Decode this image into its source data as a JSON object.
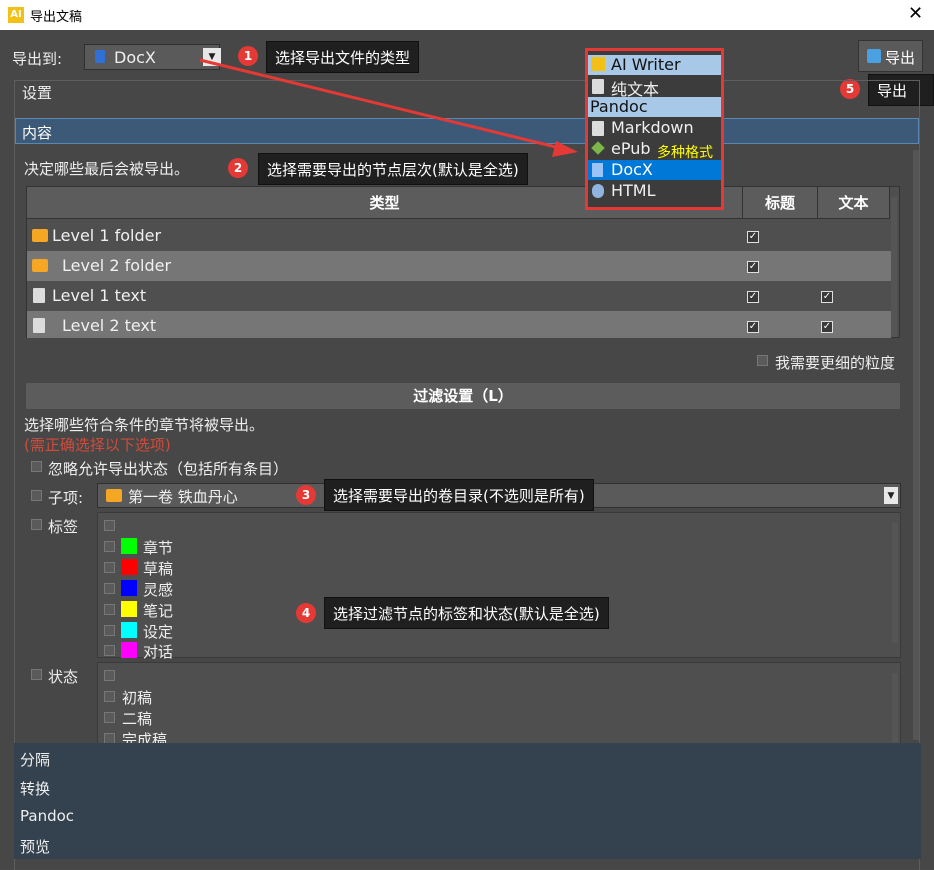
{
  "window": {
    "title": "导出文稿",
    "app_icon": "AI"
  },
  "toolbar": {
    "export_to_label": "导出到:",
    "format_value": "DocX",
    "export_button": "导出"
  },
  "tab": {
    "settings_label": "设置"
  },
  "content_section": {
    "header": "内容",
    "description": "决定哪些最后会被导出。",
    "table": {
      "headers": [
        "类型",
        "标题",
        "文本"
      ],
      "rows": [
        {
          "label": "Level 1 folder",
          "icon": "folder-icon",
          "title": true,
          "text": null
        },
        {
          "label": "Level 2 folder",
          "icon": "folder-icon",
          "title": true,
          "text": null
        },
        {
          "label": "Level 1 text",
          "icon": "document-icon",
          "title": true,
          "text": true
        },
        {
          "label": "Level 2 text",
          "icon": "document-icon",
          "title": true,
          "text": true
        }
      ]
    },
    "finer_granularity": "我需要更细的粒度"
  },
  "filter_section": {
    "header": "过滤设置（L）",
    "description": "选择哪些符合条件的章节将被导出。",
    "warning": "(需正确选择以下选项)",
    "ignore_status_label": "忽略允许导出状态（包括所有条目）",
    "subitem_label": "子项:",
    "subitem_value": "第一卷 铁血丹心",
    "tags_label": "标签",
    "tags": [
      {
        "name": "章节",
        "color": "#00ff00"
      },
      {
        "name": "草稿",
        "color": "#ff0000"
      },
      {
        "name": "灵感",
        "color": "#0000ff"
      },
      {
        "name": "笔记",
        "color": "#ffff00"
      },
      {
        "name": "设定",
        "color": "#00ffff"
      },
      {
        "name": "对话",
        "color": "#ff00ff"
      }
    ],
    "status_label": "状态",
    "statuses": [
      "初稿",
      "二稿",
      "完成稿"
    ]
  },
  "bottom_nav": [
    "分隔",
    "转换",
    "Pandoc",
    "预览"
  ],
  "format_dropdown": {
    "items": [
      {
        "label": "AI Writer",
        "icon": "ai-writer-icon",
        "style": "highlight"
      },
      {
        "label": "纯文本",
        "icon": "document-icon",
        "style": "normal"
      },
      {
        "label": "Pandoc",
        "icon": "",
        "style": "highlight"
      },
      {
        "label": "Markdown",
        "icon": "document-icon",
        "style": "normal"
      },
      {
        "label": "ePub",
        "icon": "epub-icon",
        "style": "normal"
      },
      {
        "label": "DocX",
        "icon": "docx-icon",
        "style": "selected"
      },
      {
        "label": "HTML",
        "icon": "html-icon",
        "style": "normal"
      }
    ],
    "annotation": "多种格式"
  },
  "annotations": [
    {
      "number": "1",
      "text": "选择导出文件的类型"
    },
    {
      "number": "2",
      "text": "选择需要导出的节点层次(默认是全选)"
    },
    {
      "number": "3",
      "text": "选择需要导出的卷目录(不选则是所有)"
    },
    {
      "number": "4",
      "text": "选择过滤节点的标签和状态(默认是全选)"
    },
    {
      "number": "5",
      "text": "导出"
    }
  ],
  "colors": {
    "accent_red": "#e53935",
    "selection_blue": "#0078d7",
    "highlight_blue": "#a8c8e8",
    "annotation_yellow": "#ffff00"
  }
}
